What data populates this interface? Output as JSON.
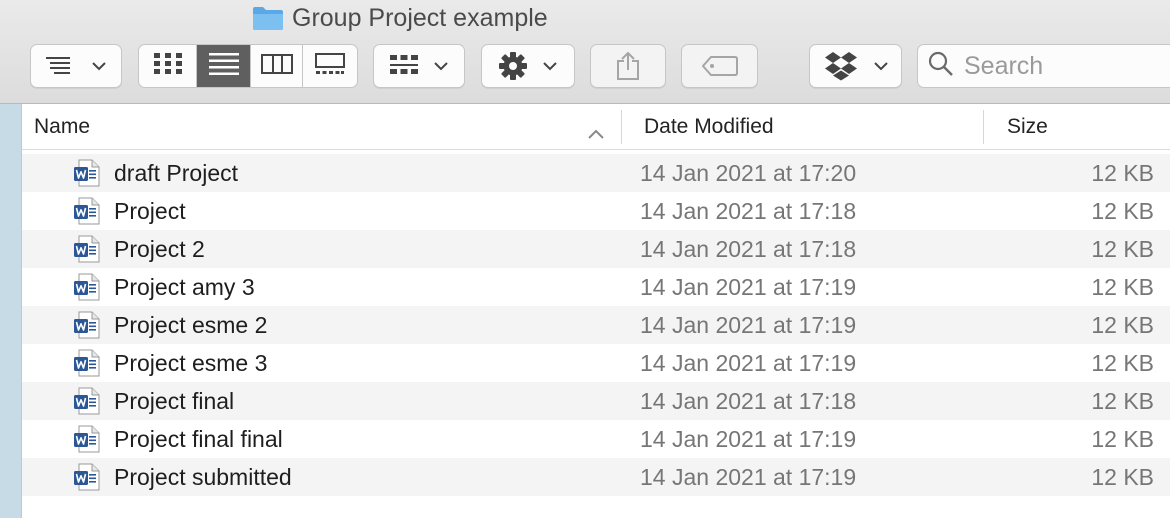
{
  "window": {
    "title": "Group Project example"
  },
  "toolbar": {
    "arrange_button": "list-arrange-icon",
    "view_modes": [
      "icon-view-icon",
      "list-view-icon",
      "column-view-icon",
      "gallery-view-icon"
    ],
    "active_view": "list",
    "group_button": "group-icon",
    "action_button": "gear-icon",
    "share_button": "share-icon",
    "tags_button": "tag-icon",
    "dropbox_button": "dropbox-icon",
    "search_placeholder": "Search"
  },
  "columns": {
    "name": "Name",
    "date_modified": "Date Modified",
    "size": "Size",
    "sort_direction": "ascending"
  },
  "files": [
    {
      "name": "draft Project",
      "date": "14 Jan 2021 at 17:20",
      "size": "12 KB"
    },
    {
      "name": "Project",
      "date": "14 Jan 2021 at 17:18",
      "size": "12 KB"
    },
    {
      "name": "Project 2",
      "date": "14 Jan 2021 at 17:18",
      "size": "12 KB"
    },
    {
      "name": "Project amy 3",
      "date": "14 Jan 2021 at 17:19",
      "size": "12 KB"
    },
    {
      "name": "Project esme 2",
      "date": "14 Jan 2021 at 17:19",
      "size": "12 KB"
    },
    {
      "name": "Project esme 3",
      "date": "14 Jan 2021 at 17:19",
      "size": "12 KB"
    },
    {
      "name": "Project final",
      "date": "14 Jan 2021 at 17:18",
      "size": "12 KB"
    },
    {
      "name": "Project final final",
      "date": "14 Jan 2021 at 17:19",
      "size": "12 KB"
    },
    {
      "name": "Project submitted",
      "date": "14 Jan 2021 at 17:19",
      "size": "12 KB"
    }
  ],
  "colors": {
    "folder": "#5aa9e6",
    "word_blue": "#2b5797",
    "active_segment": "#5f5f5f",
    "sidebar": "#c6dbe6"
  }
}
